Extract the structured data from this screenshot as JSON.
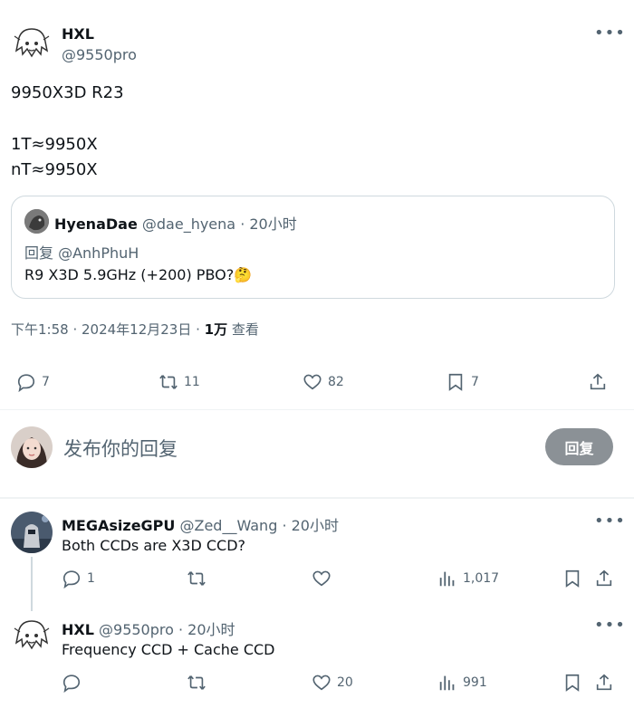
{
  "main_tweet": {
    "author_name": "HXL",
    "author_handle": "@9550pro",
    "text_lines": [
      "9950X3D R23",
      "1T≈9950X",
      "nT≈9950X"
    ],
    "quote": {
      "author_name": "HyenaDae",
      "author_handle": "@dae_hyena",
      "time": "· 20小时",
      "reply_to": "回复 @AnhPhuH",
      "text": "R9 X3D 5.9GHz (+200) PBO?🤔"
    },
    "meta_time": "下午1:58 · 2024年12月23日 · ",
    "meta_views": "1万",
    "meta_views_label": " 查看",
    "actions": {
      "replies": "7",
      "retweets": "11",
      "likes": "82",
      "bookmarks": "7"
    }
  },
  "compose": {
    "placeholder": "发布你的回复",
    "reply_button": "回复"
  },
  "replies": [
    {
      "author_name": "MEGAsizeGPU",
      "author_handle": "@Zed__Wang",
      "time": "· 20小时",
      "text": "Both CCDs are X3D CCD?",
      "replies": "1",
      "retweets": "",
      "likes": "",
      "views": "1,017"
    },
    {
      "author_name": "HXL",
      "author_handle": "@9550pro",
      "time": "· 20小时",
      "text": "Frequency CCD + Cache CCD",
      "replies": "",
      "retweets": "",
      "likes": "20",
      "views": "991"
    }
  ],
  "colors": {
    "text": "#0f1419",
    "secondary": "#536471",
    "border": "#cfd9de",
    "reply_button_bg": "#8b9196",
    "thread_line": "#cfd9de"
  },
  "icons": {
    "more": "more-icon",
    "reply": "reply-icon",
    "retweet": "retweet-icon",
    "like": "heart-icon",
    "bookmark": "bookmark-icon",
    "share": "share-icon",
    "views": "views-icon"
  }
}
